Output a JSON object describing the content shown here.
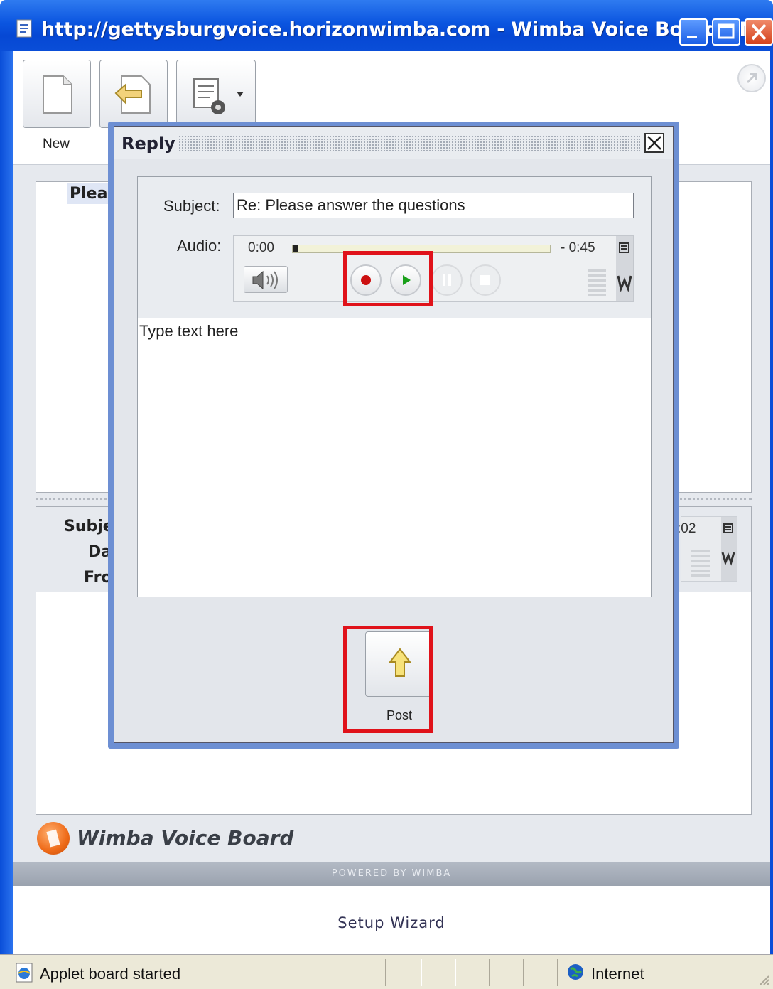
{
  "window": {
    "title": "http://gettysburgvoice.horizonwimba.com - Wimba Voice Board - Mic..."
  },
  "toolbar": {
    "new_label": "New"
  },
  "board": {
    "message_title_partial": "Pleas",
    "subject_label_partial": "Subje",
    "date_label_partial": "Da",
    "from_label_partial": "Fro",
    "mini_player_time_partial": ":02",
    "logo_text": "Wimba Voice Board",
    "powered_by": "POWERED BY WIMBA",
    "setup_link": "Setup Wizard"
  },
  "dialog": {
    "title": "Reply",
    "subject_label": "Subject:",
    "subject_value": "Re: Please answer the questions",
    "audio_label": "Audio:",
    "time_current": "0:00",
    "time_remaining": "- 0:45",
    "progress_fraction": 0.0,
    "text_placeholder": "Type text here",
    "post_label": "Post"
  },
  "status": {
    "message": "Applet board started",
    "zone": "Internet"
  },
  "colors": {
    "titlebar": "#0b55e0",
    "highlight": "#e0121a",
    "record": "#cc1010",
    "play": "#1aa01a"
  }
}
